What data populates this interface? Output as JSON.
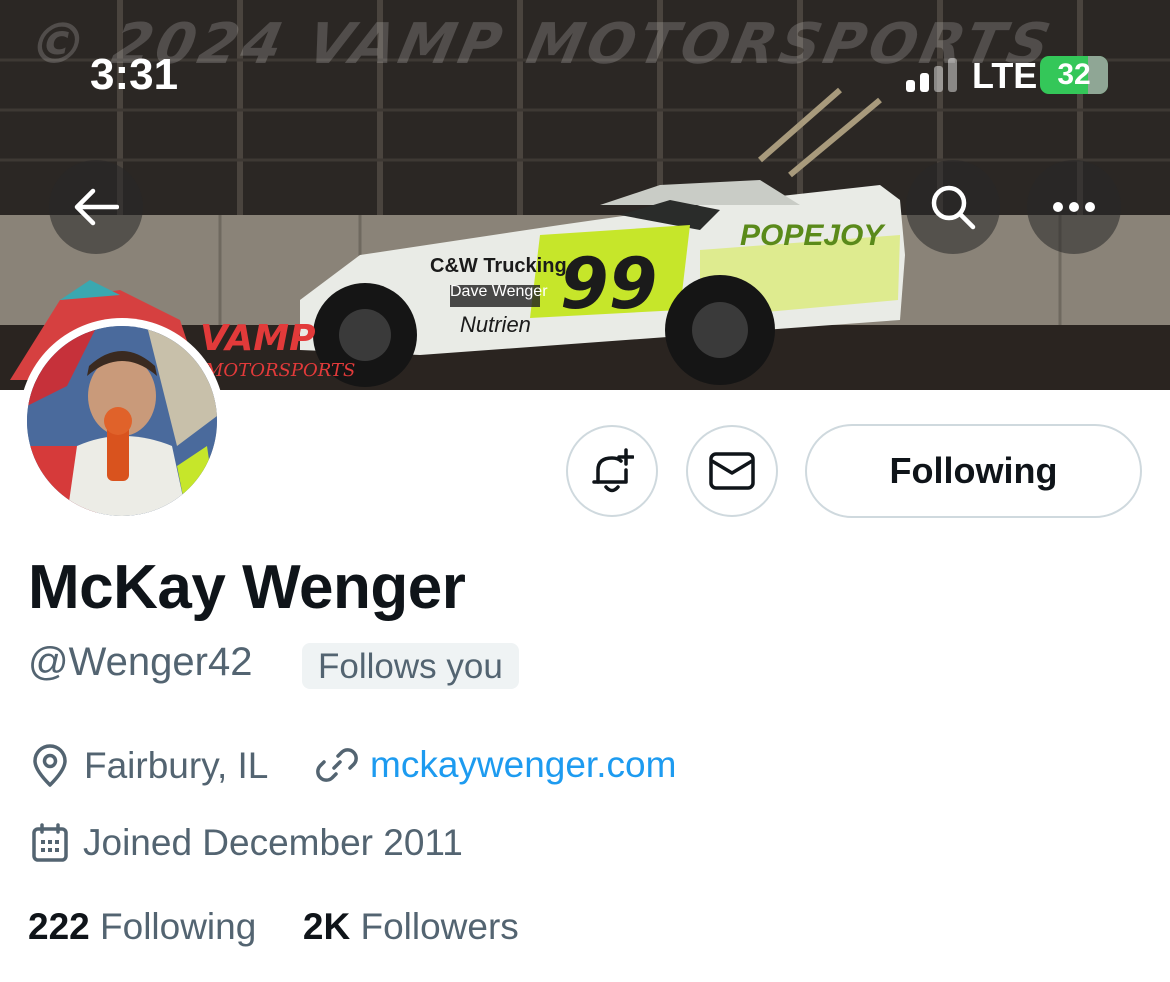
{
  "status_bar": {
    "time": "3:31",
    "network": "LTE",
    "battery": "32"
  },
  "banner": {
    "watermark": "© 2024 VAMP MOTORSPORTS",
    "brand_text": "VAMP",
    "brand_subtext": "MOTORSPORTS",
    "car_number": "99",
    "sponsor_1": "C&W Trucking",
    "sponsor_2": "POPEJOY",
    "sponsor_3": "Dave Wenger",
    "sponsor_4": "Nutrien"
  },
  "profile": {
    "display_name": "McKay Wenger",
    "handle": "@Wenger42",
    "follows_you": "Follows you",
    "location": "Fairbury, IL",
    "website": "mckaywenger.com",
    "joined": "Joined December 2011",
    "following_count": "222",
    "following_label": "Following",
    "followers_count": "2K",
    "followers_label": "Followers"
  },
  "actions": {
    "following_button": "Following"
  },
  "icons": {
    "back": "arrow-left-icon",
    "search": "search-icon",
    "more": "more-icon",
    "notify": "bell-plus-icon",
    "message": "envelope-icon",
    "location": "map-pin-icon",
    "link": "link-icon",
    "calendar": "calendar-icon"
  },
  "colors": {
    "link": "#1d9bf0",
    "secondary_text": "#536471",
    "border": "#cfd9de",
    "battery": "#34c759",
    "car_accent": "#c6e62a"
  }
}
